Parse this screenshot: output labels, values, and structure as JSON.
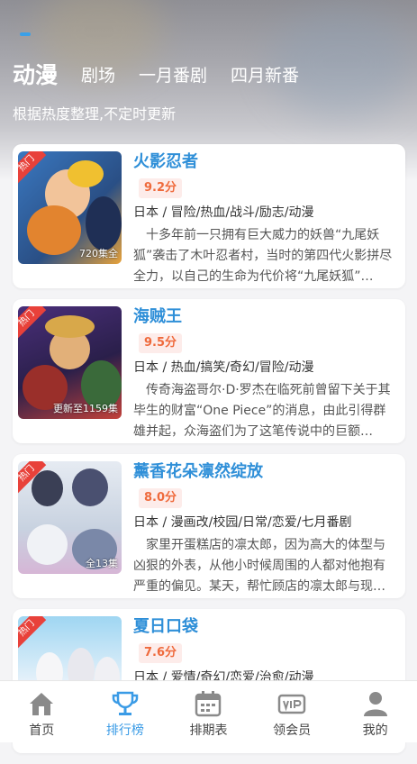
{
  "header": {
    "tabs": [
      {
        "label": "动漫",
        "active": true
      },
      {
        "label": "剧场",
        "active": false
      },
      {
        "label": "一月番剧",
        "active": false
      },
      {
        "label": "四月新番",
        "active": false
      }
    ],
    "subtitle": "根据热度整理,不定时更新"
  },
  "badge_label": "热门",
  "items": [
    {
      "title": "火影忍者",
      "score": "9.2分",
      "tags": "日本 / 冒险/热血/战斗/励志/动漫",
      "desc": "十多年前一只拥有巨大威力的妖兽“九尾妖狐”袭击了木叶忍者村，当时的第四代火影拼尽全力，以自己的生命为代价将“九尾妖狐”…",
      "episodes": "720集全",
      "poster_colors": [
        "#2f6bb0",
        "#e8a23a",
        "#f2c49a"
      ]
    },
    {
      "title": "海贼王",
      "score": "9.5分",
      "tags": "日本 / 热血/搞笑/奇幻/冒险/动漫",
      "desc": "传奇海盗哥尔·D·罗杰在临死前曾留下关于其毕生的财富“One Piece”的消息，由此引得群雄并起，众海盗们为了这笔传说中的巨额…",
      "episodes": "更新至1159集",
      "poster_colors": [
        "#5a3a8a",
        "#d8a84a",
        "#c2413a"
      ]
    },
    {
      "title": "薰香花朵凛然绽放",
      "score": "8.0分",
      "tags": "日本 / 漫画改/校园/日常/恋爱/七月番剧",
      "desc": "家里开蛋糕店的凛太郎，因为高大的体型与凶狠的外表，从他小时候周围的人都对他抱有严重的偏见。某天，帮忙顾店的凛太郎与现…",
      "episodes": "全13集",
      "poster_colors": [
        "#dfe6ef",
        "#6d7fa0",
        "#c9a3c7"
      ]
    },
    {
      "title": "夏日口袋",
      "score": "7.6分",
      "tags": "日本 / 爱情/奇幻/恋爱/治愈/动漫",
      "desc": "",
      "episodes": "",
      "poster_colors": [
        "#8fd0ee",
        "#f3f6fb",
        "#b6dc9a"
      ]
    }
  ],
  "bottom_nav": [
    {
      "label": "首页",
      "icon": "home-icon",
      "active": false
    },
    {
      "label": "排行榜",
      "icon": "trophy-icon",
      "active": true
    },
    {
      "label": "排期表",
      "icon": "calendar-icon",
      "active": false
    },
    {
      "label": "领会员",
      "icon": "vip-icon",
      "active": false
    },
    {
      "label": "我的",
      "icon": "user-icon",
      "active": false
    }
  ],
  "colors": {
    "accent": "#3a9be6",
    "title": "#2f8fd8",
    "score": "#ef6a3c",
    "hot": "#e8413a"
  }
}
